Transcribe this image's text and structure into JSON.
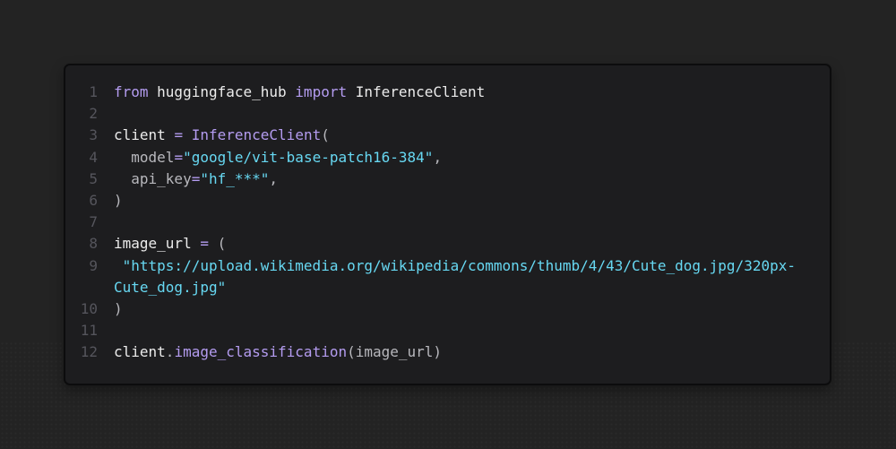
{
  "editor": {
    "lines": [
      {
        "n": "1",
        "tokens": {
          "t1": "from",
          "t2": " huggingface_hub ",
          "t3": "import",
          "t4": " InferenceClient"
        }
      },
      {
        "n": "2"
      },
      {
        "n": "3",
        "tokens": {
          "t1": "client ",
          "t2": "=",
          "t3": " ",
          "t4": "InferenceClient",
          "t5": "("
        }
      },
      {
        "n": "4",
        "tokens": {
          "t1": "  model",
          "t2": "=",
          "t3": "\"google/vit-base-patch16-384\"",
          "t4": ","
        }
      },
      {
        "n": "5",
        "tokens": {
          "t1": "  api_key",
          "t2": "=",
          "t3": "\"hf_***\"",
          "t4": ","
        }
      },
      {
        "n": "6",
        "tokens": {
          "t1": ")"
        }
      },
      {
        "n": "7"
      },
      {
        "n": "8",
        "tokens": {
          "t1": "image_url ",
          "t2": "=",
          "t3": " ("
        }
      },
      {
        "n": "9",
        "tokens": {
          "t1": " \"https://upload.wikimedia.org/wikipedia/commons/thumb/4/43/Cute_dog.jpg/320px-"
        }
      },
      {
        "n": "",
        "tokens": {
          "t1": "Cute_dog.jpg\""
        }
      },
      {
        "n": "10",
        "tokens": {
          "t1": ")"
        }
      },
      {
        "n": "11"
      },
      {
        "n": "12",
        "tokens": {
          "t1": "client",
          "t2": ".",
          "t3": "image_classification",
          "t4": "(image_url)"
        }
      }
    ]
  },
  "colors": {
    "background": "#232323",
    "panel": "#1d1d1f",
    "keyword": "#b49cf0",
    "string": "#67d8f2",
    "text": "#ececec",
    "line_number": "#55555c"
  }
}
